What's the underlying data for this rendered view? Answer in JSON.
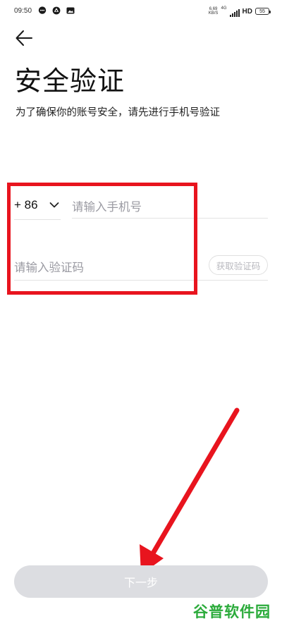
{
  "status_bar": {
    "time": "09:50",
    "net_speed_top": "6.69",
    "net_speed_bottom": "KB/S",
    "signal_tag": "4G",
    "hd": "HD",
    "battery": "55"
  },
  "header": {
    "title": "安全验证",
    "subtitle": "为了确保你的账号安全，请先进行手机号验证"
  },
  "form": {
    "country_code": "+ 86",
    "phone_placeholder": "请输入手机号",
    "code_placeholder": "请输入验证码",
    "get_code_label": "获取验证码"
  },
  "footer": {
    "next_label": "下一步"
  },
  "watermark": {
    "text": "谷普软件园"
  },
  "colors": {
    "annotation": "#e8141e",
    "button_disabled": "#dcdde1",
    "placeholder": "#9a9aa2",
    "watermark_green": "#2bab3b"
  },
  "icons": {
    "status": [
      "message-bubble-icon",
      "app-icon",
      "image-icon"
    ],
    "back": "arrow-left-icon",
    "dropdown": "chevron-down-icon"
  }
}
